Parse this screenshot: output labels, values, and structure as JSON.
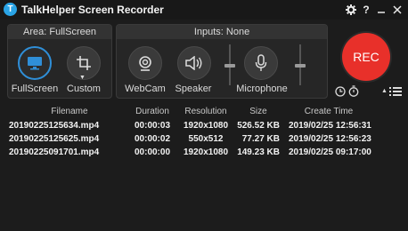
{
  "titlebar": {
    "app_title": "TalkHelper Screen Recorder",
    "logo_letter": "T"
  },
  "area": {
    "heading": "Area: FullScreen",
    "fullscreen_label": "FullScreen",
    "custom_label": "Custom"
  },
  "inputs": {
    "heading": "Inputs: None",
    "webcam_label": "WebCam",
    "speaker_label": "Speaker",
    "microphone_label": "Microphone"
  },
  "rec": {
    "label": "REC"
  },
  "colors": {
    "accent": "#2f8fd8",
    "rec_red": "#e8302a",
    "background": "#1c1c1c"
  },
  "table": {
    "headers": {
      "filename": "Filename",
      "duration": "Duration",
      "resolution": "Resolution",
      "size": "Size",
      "create_time": "Create Time"
    },
    "rows": [
      {
        "filename": "20190225125634.mp4",
        "duration": "00:00:03",
        "resolution": "1920x1080",
        "size": "526.52 KB",
        "create_time": "2019/02/25 12:56:31"
      },
      {
        "filename": "20190225125625.mp4",
        "duration": "00:00:02",
        "resolution": "550x512",
        "size": "77.27 KB",
        "create_time": "2019/02/25 12:56:23"
      },
      {
        "filename": "20190225091701.mp4",
        "duration": "00:00:00",
        "resolution": "1920x1080",
        "size": "149.23 KB",
        "create_time": "2019/02/25 09:17:00"
      }
    ]
  }
}
